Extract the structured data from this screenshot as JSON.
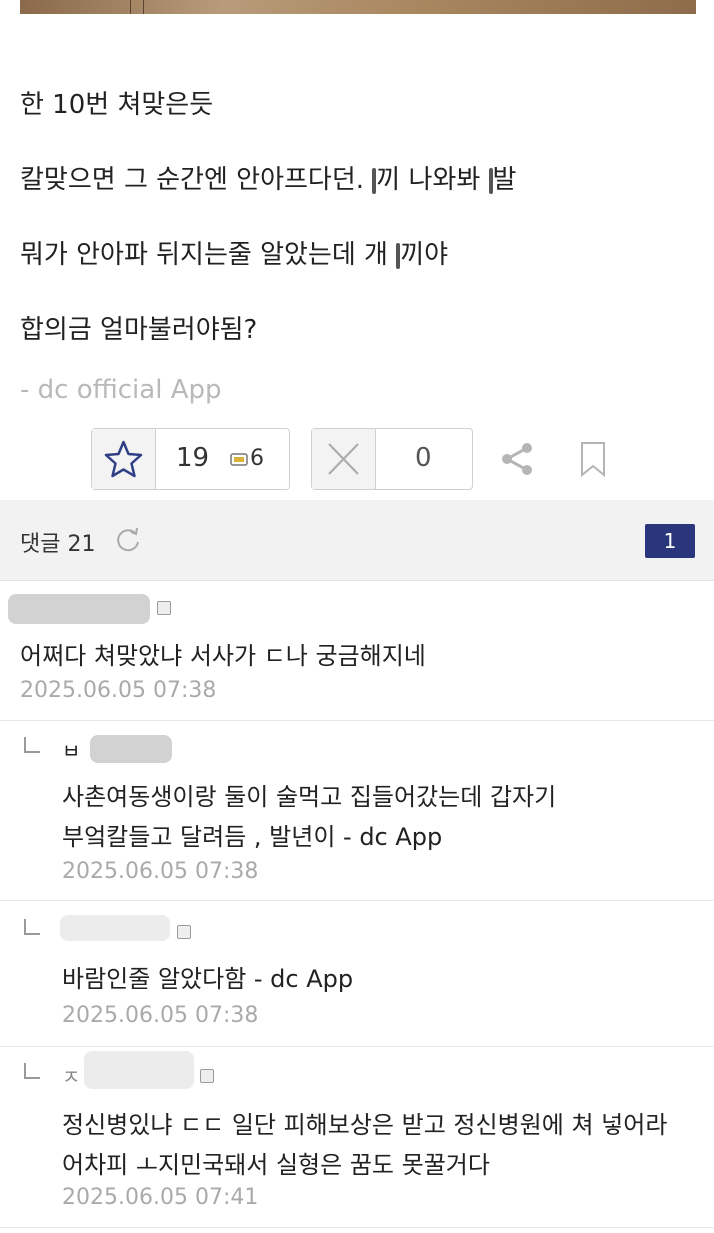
{
  "post": {
    "lines": [
      "한 10번 쳐맞은듯",
      "칼맞으면 그 순간엔 안아프다던.  ",
      "끼 나와봐   ",
      "발",
      "뭐가 안아파 뒤지는줄 알았는데 개  ",
      "끼야",
      "합의금 얼마불러야됨?"
    ],
    "signature": "- dc official App"
  },
  "votes": {
    "recommend_count": "19",
    "fixed_recommend": "6",
    "nonrecommend_count": "0"
  },
  "comments_header": {
    "label": "댓글 21",
    "page": "1"
  },
  "comments": [
    {
      "text1": "어쩌다 쳐맞았냐 서사가 ㄷ나 궁금해지네",
      "date": "2025.06.05 07:38"
    },
    {
      "nick": "ㅂ",
      "text1": "사촌여동생이랑 둘이 술먹고 집들어갔는데 갑자기",
      "text2": "부엌칼들고 달려듬 ,  발년이 - dc App",
      "date": "2025.06.05 07:38"
    },
    {
      "text1": "바람인줄 알았다함 - dc App",
      "date": "2025.06.05 07:38"
    },
    {
      "nick": "ㅈ",
      "text1": "정신병있냐 ㄷㄷ 일단 피해보상은 받고 정신병원에 쳐 넣어라",
      "text2": "어차피 ㅗ지민국돼서 실형은 꿈도 못꿀거다",
      "date": "2025.06.05 07:41"
    }
  ],
  "icons": {
    "star": "star-icon",
    "x": "x-icon",
    "share": "share-icon",
    "bookmark": "bookmark-icon",
    "refresh": "refresh-icon"
  },
  "colors": {
    "page_badge": "#29367c",
    "meta_gray": "#aaaaaa"
  }
}
